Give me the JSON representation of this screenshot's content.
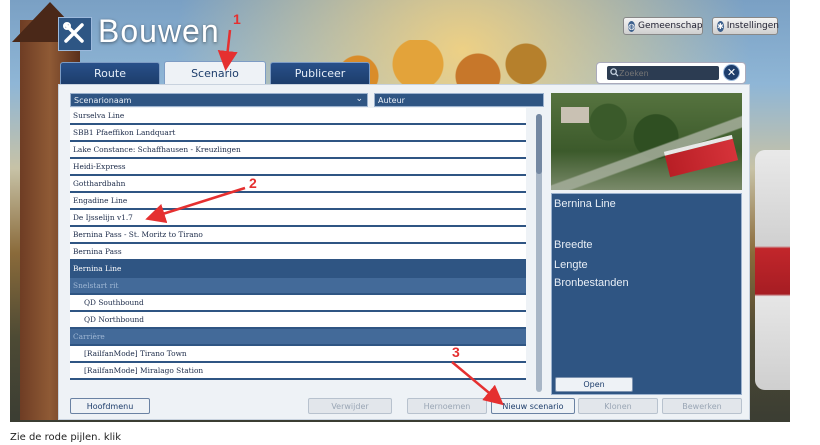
{
  "header": {
    "title": "Bouwen"
  },
  "top_buttons": {
    "community": "Gemeenschap",
    "settings": "Instellingen"
  },
  "tabs": [
    {
      "label": "Route"
    },
    {
      "label": "Scenario"
    },
    {
      "label": "Publiceer"
    }
  ],
  "search": {
    "placeholder": "Zoeken"
  },
  "columns": {
    "name": "Scenarionaam",
    "author": "Auteur"
  },
  "list": [
    {
      "label": "Surselva Line",
      "kind": "route"
    },
    {
      "label": "SBB1 Pfaeffikon Landquart",
      "kind": "route"
    },
    {
      "label": "Lake Constance: Schaffhausen - Kreuzlingen",
      "kind": "route"
    },
    {
      "label": "Heidi-Express",
      "kind": "route"
    },
    {
      "label": "Gotthardbahn",
      "kind": "route"
    },
    {
      "label": "Engadine Line",
      "kind": "route"
    },
    {
      "label": "De Ijsselijn v1.7",
      "kind": "route"
    },
    {
      "label": "Bernina Pass - St. Moritz to Tirano",
      "kind": "route"
    },
    {
      "label": "Bernina Pass",
      "kind": "route"
    },
    {
      "label": "Bernina Line",
      "kind": "selected"
    },
    {
      "label": "Snelstart rit",
      "kind": "group"
    },
    {
      "label": "QD Southbound",
      "kind": "sub"
    },
    {
      "label": "QD Northbound",
      "kind": "sub"
    },
    {
      "label": "Carrière",
      "kind": "group"
    },
    {
      "label": "[RailfanMode] Tirano Town",
      "kind": "sub"
    },
    {
      "label": "[RailfanMode] Miralago Station",
      "kind": "sub"
    }
  ],
  "details": {
    "name": "Bernina Line",
    "width_label": "Breedte",
    "length_label": "Lengte",
    "sources_label": "Bronbestanden",
    "open": "Open"
  },
  "bottom_buttons": {
    "main_menu": "Hoofdmenu",
    "delete": "Verwijder",
    "rename": "Hernoemen",
    "new_scenario": "Nieuw scenario",
    "clone": "Klonen",
    "edit": "Bewerken"
  },
  "annotations": [
    "1",
    "2",
    "3"
  ],
  "caption": "Zie de rode pijlen. klik"
}
